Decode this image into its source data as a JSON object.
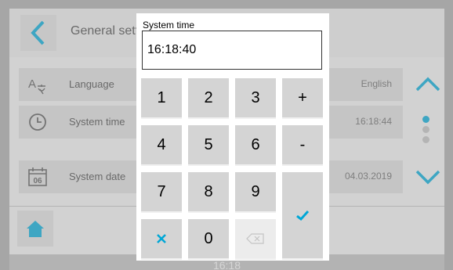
{
  "header": {
    "title": "General settings"
  },
  "settings_rows": [
    {
      "label": "Language",
      "value": "English",
      "icon": "translate-icon"
    },
    {
      "label": "System time",
      "value": "16:18:44",
      "icon": "clock-icon"
    },
    {
      "label": "System date",
      "value": "04.03.2019",
      "icon": "calendar-icon",
      "icon_text": "06"
    }
  ],
  "status_bar": {
    "clock": "16:18"
  },
  "dialog": {
    "title": "System time",
    "value": "16:18:40",
    "keys": {
      "k1": "1",
      "k2": "2",
      "k3": "3",
      "plus": "+",
      "k4": "4",
      "k5": "5",
      "k6": "6",
      "minus": "-",
      "k7": "7",
      "k8": "8",
      "k9": "9",
      "k0": "0",
      "cancel_icon": "close-icon",
      "backspace_icon": "backspace-icon",
      "confirm_icon": "checkmark-icon"
    }
  },
  "colors": {
    "accent": "#00a7d6",
    "key_bg": "#d4d4d4",
    "overlay": "#a6a6a6"
  }
}
